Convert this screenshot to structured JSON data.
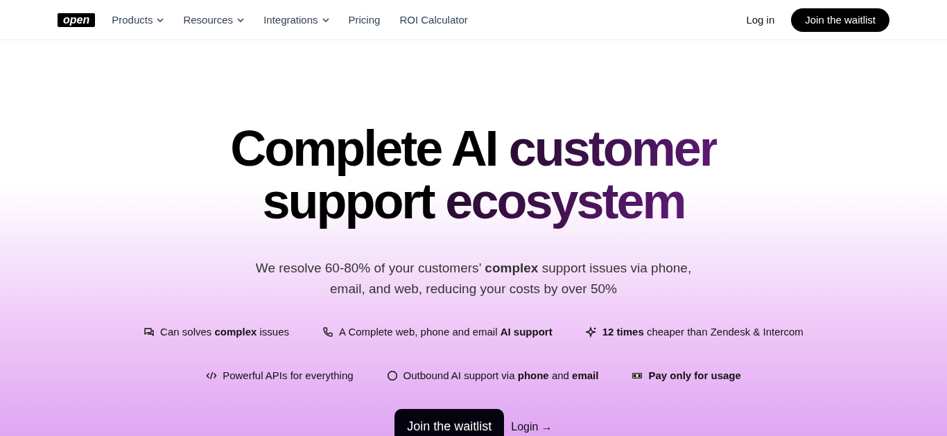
{
  "nav": {
    "logo": "open",
    "items": [
      {
        "label": "Products",
        "dropdown": true
      },
      {
        "label": "Resources",
        "dropdown": true
      },
      {
        "label": "Integrations",
        "dropdown": true
      },
      {
        "label": "Pricing",
        "dropdown": false
      },
      {
        "label": "ROI Calculator",
        "dropdown": false
      }
    ],
    "login": "Log in",
    "cta": "Join the waitlist"
  },
  "hero": {
    "headline": [
      [
        {
          "text": "Complete AI ",
          "accent": false
        },
        {
          "text": "customer",
          "accent": true
        }
      ],
      [
        {
          "text": "support ",
          "accent": false
        },
        {
          "text": "ecosystem",
          "accent": true
        }
      ]
    ],
    "subtitle": "We resolve 60-80% of your customers’ **complex** support issues via phone, email, and web, reducing your costs by over 50%",
    "feature_rows": [
      [
        {
          "kind": "chat",
          "text": "Can solves **complex** issues"
        },
        {
          "kind": "phone",
          "text": "A Complete web, phone and email **AI support**"
        },
        {
          "kind": "sparkle",
          "text": "**12 times** cheaper than Zendesk & Intercom"
        }
      ],
      [
        {
          "kind": "code",
          "text": "Powerful APIs for everything"
        },
        {
          "kind": "circle",
          "text": "Outbound AI support via **phone** and **email**"
        },
        {
          "kind": "money",
          "text": "**Pay only for usage**"
        }
      ]
    ],
    "primary_button": "Join the waitlist",
    "secondary_link": "Login →"
  }
}
